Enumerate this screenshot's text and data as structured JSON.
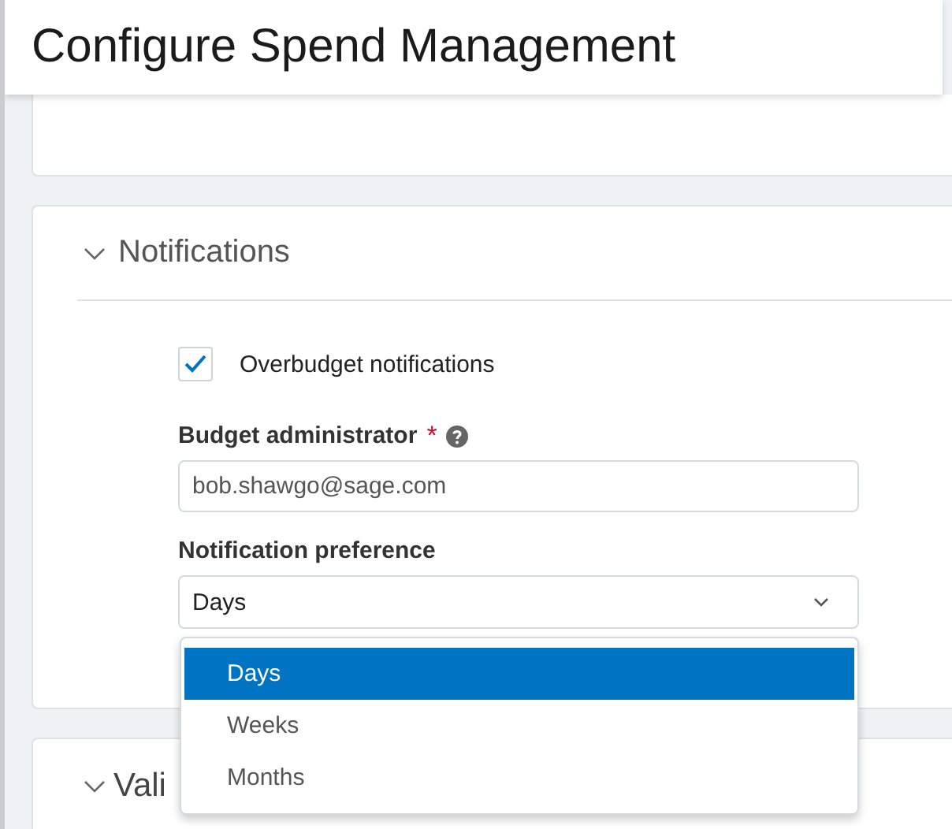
{
  "header": {
    "title": "Configure Spend Management"
  },
  "notifications": {
    "title": "Notifications",
    "expanded": true,
    "checkbox": {
      "label": "Overbudget notifications",
      "checked": true
    },
    "fields": [
      {
        "kind": "text",
        "label": "Budget administrator",
        "required": true,
        "required_mark": "*",
        "help": true,
        "value": "bob.shawgo@sage.com"
      },
      {
        "kind": "select",
        "label": "Notification preference",
        "value": "Days",
        "open": true,
        "options": [
          {
            "label": "Days",
            "selected": true
          },
          {
            "label": "Weeks",
            "selected": false
          },
          {
            "label": "Months",
            "selected": false
          }
        ]
      }
    ]
  },
  "next_section": {
    "title": "Vali",
    "expanded": true
  }
}
